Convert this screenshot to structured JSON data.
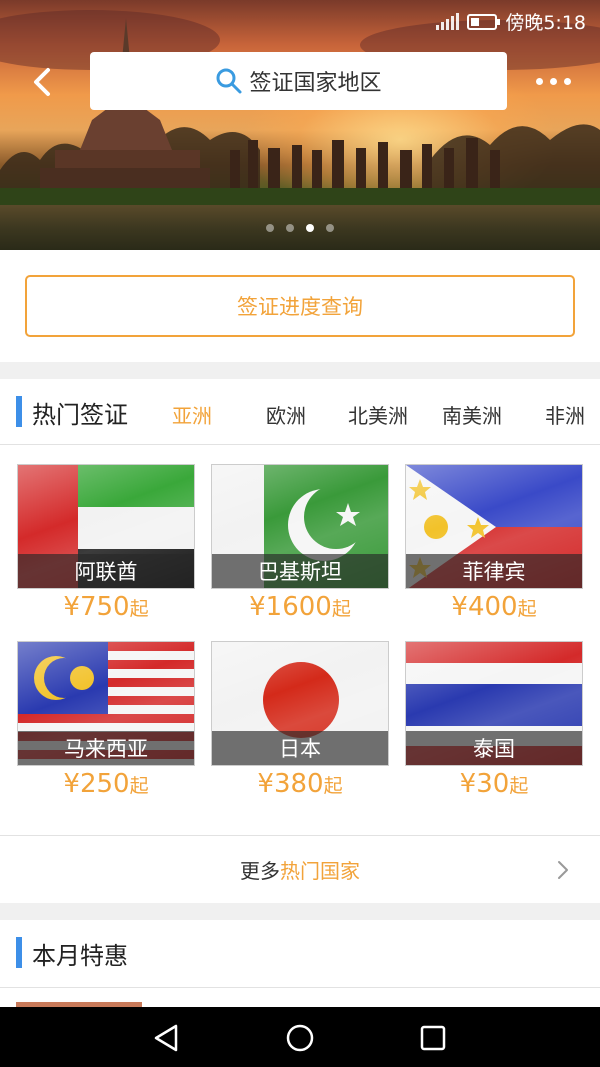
{
  "status": {
    "carrier_time": "傍晚5:18"
  },
  "header": {
    "search_label": "签证国家地区"
  },
  "banner": {
    "slide_count": 4,
    "active_slide": 2
  },
  "query": {
    "button_label": "签证进度查询"
  },
  "hot": {
    "title": "热门签证",
    "tabs": [
      {
        "label": "亚洲",
        "active": true
      },
      {
        "label": "欧洲",
        "active": false
      },
      {
        "label": "北美洲",
        "active": false
      },
      {
        "label": "南美洲",
        "active": false
      },
      {
        "label": "非洲",
        "active": false
      }
    ],
    "countries": [
      {
        "name": "阿联酋",
        "price": "¥750",
        "suffix": "起"
      },
      {
        "name": "巴基斯坦",
        "price": "¥1600",
        "suffix": "起"
      },
      {
        "name": "菲律宾",
        "price": "¥400",
        "suffix": "起"
      },
      {
        "name": "马来西亚",
        "price": "¥250",
        "suffix": "起"
      },
      {
        "name": "日本",
        "price": "¥380",
        "suffix": "起"
      },
      {
        "name": "泰国",
        "price": "¥30",
        "suffix": "起"
      }
    ],
    "more_prefix": "更多",
    "more_highlight": "热门国家"
  },
  "deals": {
    "title": "本月特惠"
  },
  "colors": {
    "accent": "#f2a33a",
    "section_bar": "#3d8fe8"
  }
}
